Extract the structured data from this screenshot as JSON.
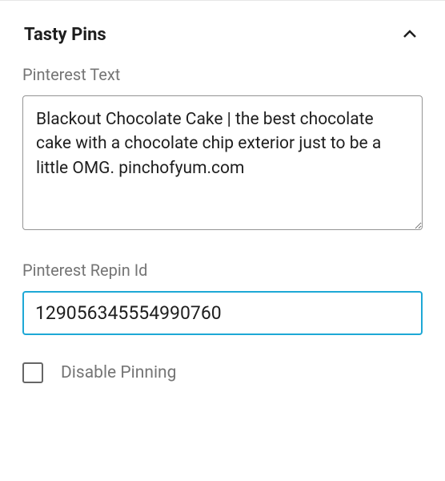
{
  "panel": {
    "title": "Tasty Pins"
  },
  "fields": {
    "pinterest_text": {
      "label": "Pinterest Text",
      "value": "Blackout Chocolate Cake | the best chocolate cake with a chocolate chip exterior just to be a little OMG. pinchofyum.com"
    },
    "repin_id": {
      "label": "Pinterest Repin Id",
      "value": "129056345554990760"
    },
    "disable_pinning": {
      "label": "Disable Pinning",
      "checked": false
    }
  }
}
